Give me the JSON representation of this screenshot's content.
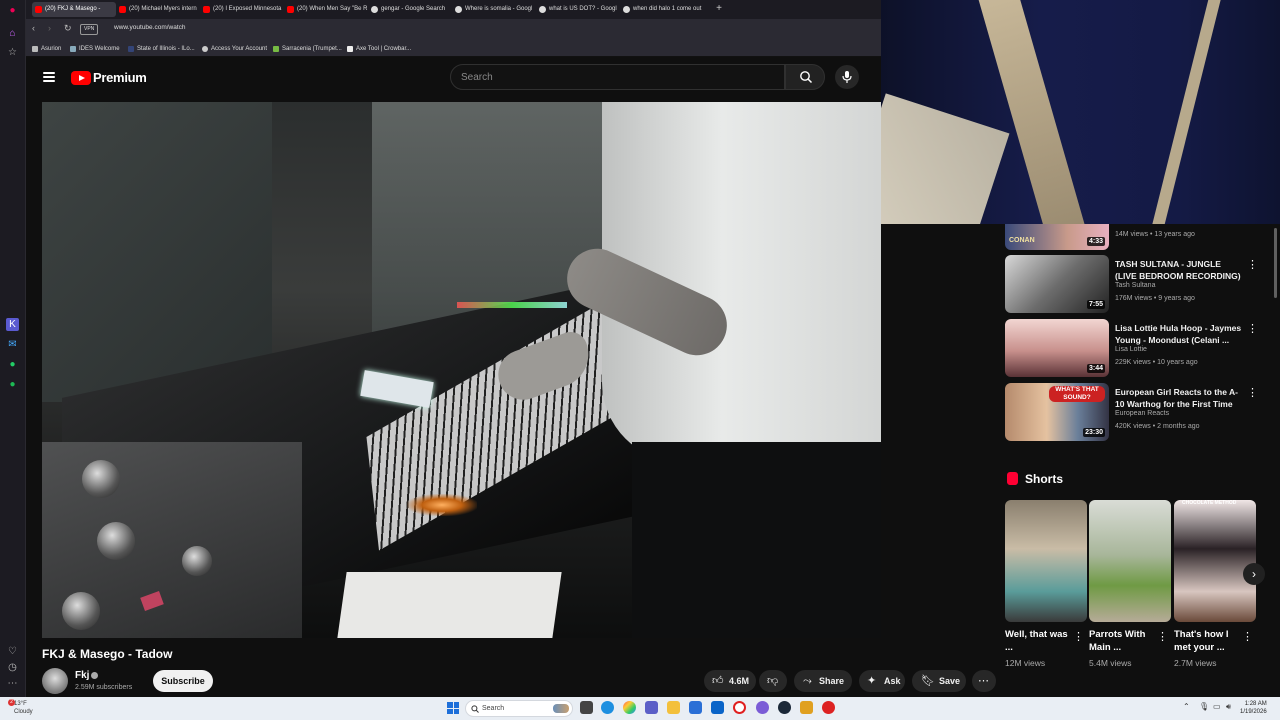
{
  "browser": {
    "tabs": [
      {
        "label": "(20) FKJ & Masego - ",
        "active": true,
        "favicon_color": "#ff0000"
      },
      {
        "label": "(20) Michael Myers intern",
        "active": false,
        "favicon_color": "#ff0000"
      },
      {
        "label": "(20) I Exposed Minnesota",
        "active": false,
        "favicon_color": "#ff0000"
      },
      {
        "label": "(20) When Men Say \"Be R",
        "active": false,
        "favicon_color": "#ff0000"
      },
      {
        "label": "gengar - Google Search",
        "active": false,
        "favicon_color": "#dddddd"
      },
      {
        "label": "Where is somalia - Googl",
        "active": false,
        "favicon_color": "#dddddd"
      },
      {
        "label": "what is US DOT? - Googl",
        "active": false,
        "favicon_color": "#dddddd"
      },
      {
        "label": "when did halo 1 come out",
        "active": false,
        "favicon_color": "#dddddd"
      }
    ],
    "new_tab_symbol": "+",
    "vpn_label": "VPN",
    "url": "www.youtube.com/watch",
    "bookmarks": [
      "Asurion",
      "IDES Welcome",
      "State of Illinois - ILo...",
      "Access Your Account",
      "Sarracenia (Trumpet...",
      "Axe Tool | Crowbar..."
    ]
  },
  "youtube": {
    "brand": "Premium",
    "search_placeholder": "Search",
    "video": {
      "title": "FKJ & Masego - Tadow",
      "channel": "Fkj",
      "subscribers": "2.59M subscribers",
      "subscribe_label": "Subscribe",
      "likes": "4.6M",
      "share_label": "Share",
      "ask_label": "Ask",
      "save_label": "Save"
    },
    "recommendations": [
      {
        "title": "",
        "channel": "",
        "meta": "14M views • 13 years ago",
        "duration": "4:33",
        "thumb_text": "CONAN"
      },
      {
        "title": "TASH SULTANA - JUNGLE (LIVE BEDROOM RECORDING)",
        "channel": "Tash Sultana",
        "meta": "176M views • 9 years ago",
        "duration": "7:55",
        "thumb_text": ""
      },
      {
        "title": "Lisa Lottie Hula Hoop - Jaymes Young - Moondust (Celani ...",
        "channel": "Lisa Lottie",
        "meta": "229K views • 10 years ago",
        "duration": "3:44",
        "thumb_text": ""
      },
      {
        "title": "European Girl Reacts to the A-10 Warthog for the First Time",
        "channel": "European Reacts",
        "meta": "420K views • 2 months ago",
        "duration": "23:30",
        "thumb_text": "WHAT'S THAT SOUND?"
      }
    ],
    "shorts_heading": "Shorts",
    "shorts": [
      {
        "title": "Well, that was ...",
        "views": "12M views"
      },
      {
        "title": "Parrots With Main ...",
        "views": "5.4M views"
      },
      {
        "title": "That's how I met your ...",
        "views": "2.7M views",
        "thumb_text": "CHOCOLATE METHOD"
      }
    ]
  },
  "taskbar": {
    "weather_temp": "13°F",
    "weather_desc": "Cloudy",
    "notification_count": "2",
    "search_placeholder": "Search",
    "time": "1:28 AM",
    "date": "1/19/2026"
  }
}
